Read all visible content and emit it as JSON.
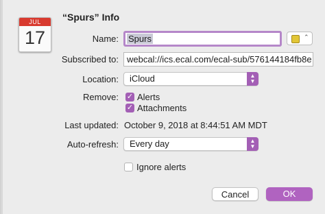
{
  "dialog": {
    "title": "“Spurs” Info"
  },
  "calendar_icon": {
    "month": "JUL",
    "day": "17"
  },
  "name": {
    "label": "Name:",
    "value": "Spurs",
    "color": "#e2c636"
  },
  "subscribed_to": {
    "label": "Subscribed to:",
    "value": "webcal://ics.ecal.com/ecal-sub/576144184fb8e"
  },
  "location": {
    "label": "Location:",
    "value": "iCloud"
  },
  "remove": {
    "label": "Remove:",
    "alerts_label": "Alerts",
    "alerts_checked": true,
    "attachments_label": "Attachments",
    "attachments_checked": true
  },
  "last_updated": {
    "label": "Last updated:",
    "value": "October 9, 2018 at 8:44:51 AM MDT"
  },
  "auto_refresh": {
    "label": "Auto-refresh:",
    "value": "Every day"
  },
  "ignore_alerts": {
    "label": "Ignore alerts",
    "checked": false
  },
  "buttons": {
    "cancel": "Cancel",
    "ok": "OK"
  },
  "colors": {
    "accent": "#a35fb5",
    "ok_button": "#b063c0"
  }
}
